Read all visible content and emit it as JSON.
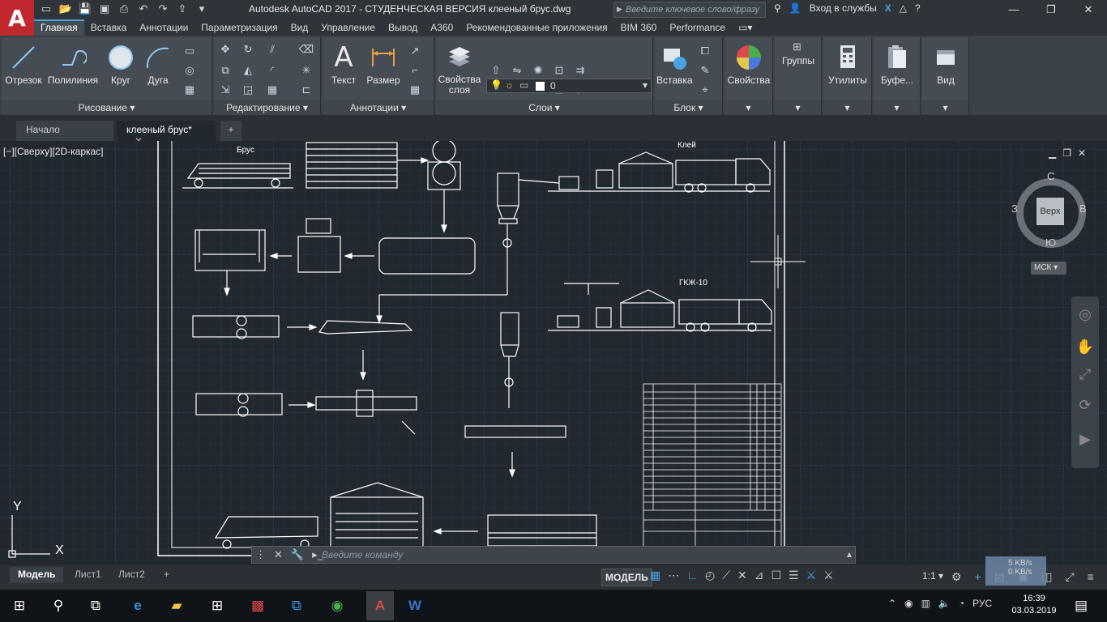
{
  "titlebar": {
    "title": "Autodesk AutoCAD 2017 - СТУДЕНЧЕСКАЯ ВЕРСИЯ    клееный брус.dwg",
    "search_placeholder": "Введите ключевое слово/фразу",
    "signin": "Вход в службы",
    "logo": "A"
  },
  "ribbon_tabs": [
    "Главная",
    "Вставка",
    "Аннотации",
    "Параметризация",
    "Вид",
    "Управление",
    "Вывод",
    "A360",
    "Рекомендованные приложения",
    "BIM 360",
    "Performance"
  ],
  "ribbon": {
    "draw": {
      "line": "Отрезок",
      "polyline": "Полилиния",
      "circle": "Круг",
      "arc": "Дуга",
      "title": "Рисование"
    },
    "modify": {
      "title": "Редактирование"
    },
    "annotation": {
      "text": "Текст",
      "dimension": "Размер",
      "title": "Аннотации"
    },
    "layers": {
      "properties": "Свойства слоя",
      "current_layer": "0",
      "title": "Слои"
    },
    "block": {
      "insert": "Вставка",
      "title": "Блок"
    },
    "properties": "Свойства",
    "groups": "Группы",
    "utilities": "Утилиты",
    "clipboard": "Буфе...",
    "view": "Вид"
  },
  "doc_tabs": {
    "start": "Начало",
    "file": "клееный брус*"
  },
  "viewport_label": "[−][Сверху][2D-каркас]",
  "viewcube": {
    "face": "Верх",
    "north": "С",
    "south": "Ю",
    "east": "В",
    "west": "З",
    "ucs": "МСК"
  },
  "drawing_labels": {
    "timber": "Брус",
    "glue": "Клей",
    "hardener": "ГКЖ-10"
  },
  "command_placeholder": "Введите команду",
  "layout_tabs": [
    "Модель",
    "Лист1",
    "Лист2"
  ],
  "status": {
    "model": "МОДЕЛЬ",
    "scale": "1:1",
    "net_speed": "5 KB/s",
    "net_speed2": "0 KB/s"
  },
  "taskbar": {
    "lang": "РУС",
    "time": "16:39",
    "date": "03.03.2019"
  },
  "ucs_axes": {
    "x": "X",
    "y": "Y"
  }
}
